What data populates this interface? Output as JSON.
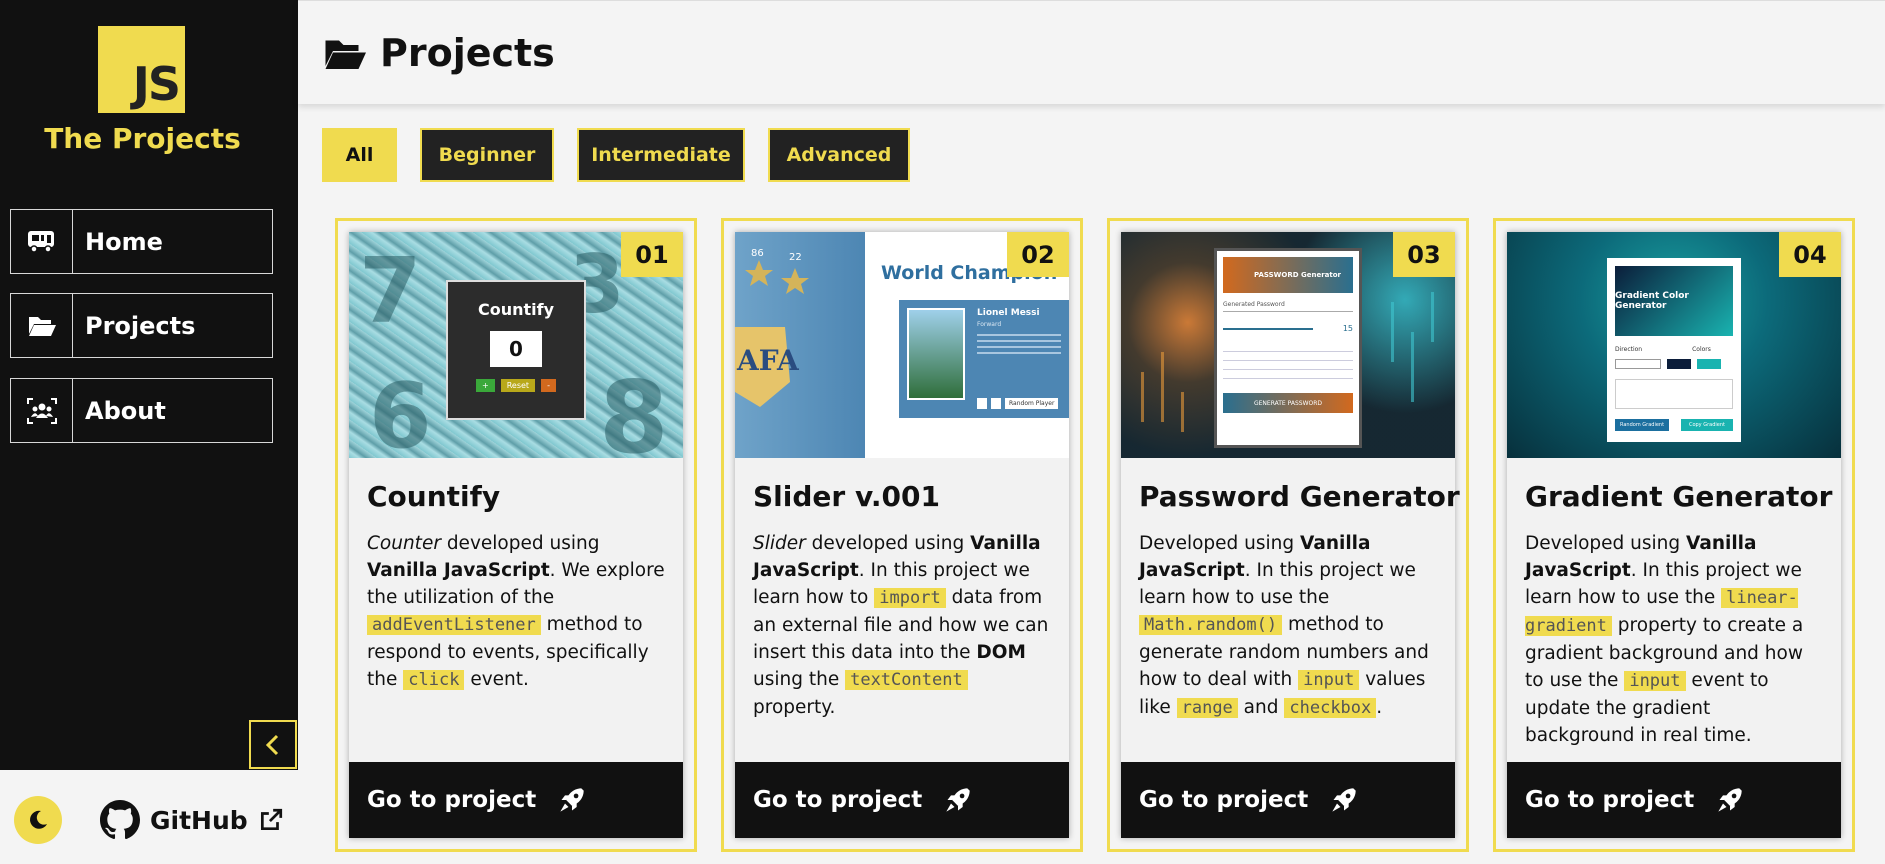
{
  "sidebar": {
    "logo_text": "JS",
    "brand": "The Projects",
    "nav": [
      {
        "label": "Home",
        "icon": "van-icon"
      },
      {
        "label": "Projects",
        "icon": "folder-open-icon"
      },
      {
        "label": "About",
        "icon": "people-icon"
      }
    ],
    "footer": {
      "github_label": "GitHub"
    }
  },
  "header": {
    "title": "Projects"
  },
  "filters": [
    "All",
    "Beginner",
    "Intermediate",
    "Advanced"
  ],
  "active_filter": "All",
  "colors": {
    "accent": "#f0db4f",
    "dark": "#111111",
    "background": "#f4f4f4"
  },
  "cards": [
    {
      "number": "01",
      "title": "Countify",
      "thumb": {
        "heading": "Countify",
        "count": "0",
        "buttons": [
          "+",
          "Reset",
          "-"
        ]
      },
      "desc": {
        "t1": "Counter",
        "t2": " developed using ",
        "t3": "Vanilla JavaScript",
        "t4": ". We explore the utilization of the ",
        "c1": "addEventListener",
        "t5": " method to respond to events, specifically the ",
        "c2": "click",
        "t6": " event."
      },
      "button": "Go to project"
    },
    {
      "number": "02",
      "title": "Slider v.001",
      "thumb": {
        "heading": "World Champion",
        "player": "Lionel Messi",
        "role": "Forward",
        "nums": [
          "86",
          "22"
        ],
        "crest": "AFA",
        "button": "Random Player"
      },
      "desc": {
        "t1": "Slider",
        "t2": " developed using ",
        "t3": "Vanilla JavaScript",
        "t4": ". In this project we learn how to ",
        "c1": "import",
        "t5": " data from an external file and how we can insert this data into the ",
        "t6": "DOM",
        "t7": " using the ",
        "c2": "textContent",
        "t8": " property."
      },
      "button": "Go to project"
    },
    {
      "number": "03",
      "title": "Password Generator",
      "thumb": {
        "heading": "PASSWORD Generator",
        "field": "Generated Password",
        "length": "15",
        "button": "GENERATE PASSWORD"
      },
      "desc": {
        "t1": "Developed using ",
        "t2": "Vanilla JavaScript",
        "t3": ". In this project we learn how to use the ",
        "c1": "Math.random()",
        "t4": " method to generate random numbers and how to deal with ",
        "c2": "input",
        "t5": " values like ",
        "c3": "range",
        "t6": " and ",
        "c4": "checkbox",
        "t7": "."
      },
      "button": "Go to project"
    },
    {
      "number": "04",
      "title": "Gradient Generator",
      "thumb": {
        "heading": "Gradient Color Generator",
        "direction": "Direction",
        "colors": "Colors",
        "btn1": "Random Gradient",
        "btn2": "Copy Gradient"
      },
      "desc": {
        "t1": "Developed using ",
        "t2": "Vanilla JavaScript",
        "t3": ". In this project we learn how to use the ",
        "c1": "linear-gradient",
        "t4": " property to create a gradient background and how to use the ",
        "c2": "input",
        "t5": " event to update the gradient background in real time."
      },
      "button": "Go to project"
    }
  ]
}
